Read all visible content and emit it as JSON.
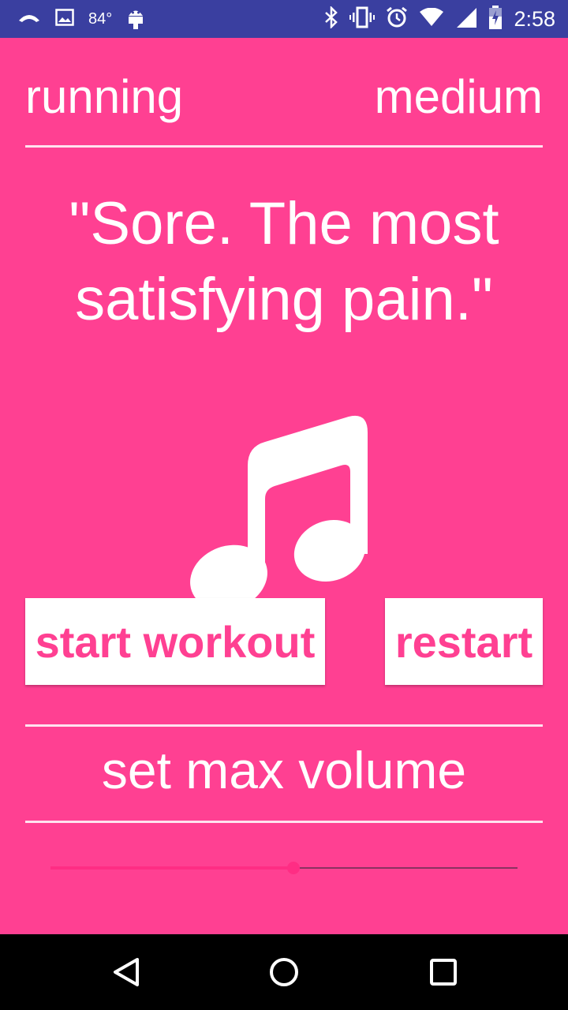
{
  "status_bar": {
    "temperature": "84°",
    "time": "2:58",
    "icons": [
      "call-icon",
      "image-icon",
      "android-icon",
      "bluetooth-icon",
      "vibrate-icon",
      "alarm-icon",
      "wifi-icon",
      "signal-icon",
      "battery-icon"
    ]
  },
  "header": {
    "activity": "running",
    "intensity": "medium"
  },
  "quote": "\"Sore. The most satisfying pain.\"",
  "icons": {
    "music": "music-note-icon"
  },
  "buttons": {
    "start_label": "start workout",
    "restart_label": "restart"
  },
  "volume": {
    "label": "set max volume",
    "level_fraction": 0.52
  },
  "colors": {
    "background": "#ff4092",
    "status_bar": "#3a3fa0",
    "accent": "#ff2d84",
    "button_bg": "#ffffff"
  },
  "nav_bar": {
    "icons": [
      "back-icon",
      "home-icon",
      "recents-icon"
    ]
  }
}
